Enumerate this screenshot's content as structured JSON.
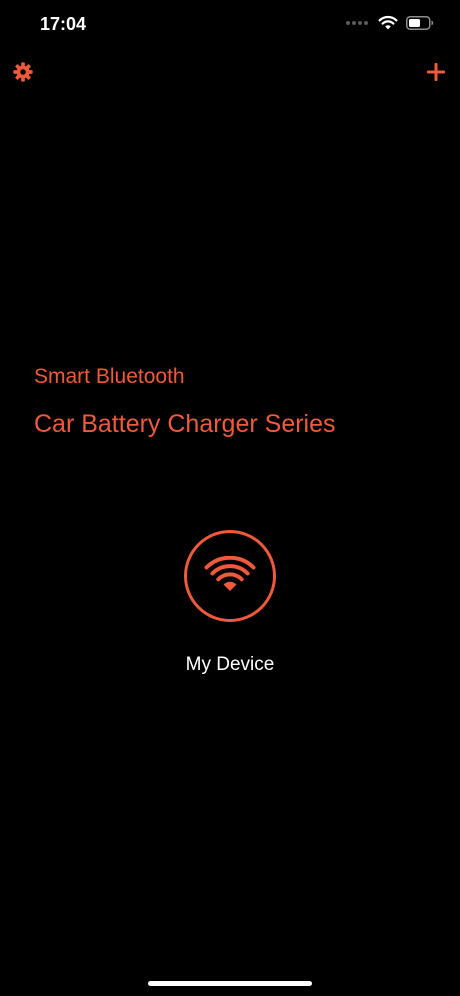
{
  "status_bar": {
    "time": "17:04"
  },
  "toolbar": {
    "settings_icon": "gear-icon",
    "add_icon": "plus-icon"
  },
  "header": {
    "subtitle": "Smart Bluetooth",
    "title": "Car Battery Charger Series"
  },
  "device": {
    "icon": "wifi-icon",
    "label": "My Device"
  },
  "colors": {
    "accent": "#f05a3c",
    "background": "#000000",
    "text": "#ffffff"
  }
}
